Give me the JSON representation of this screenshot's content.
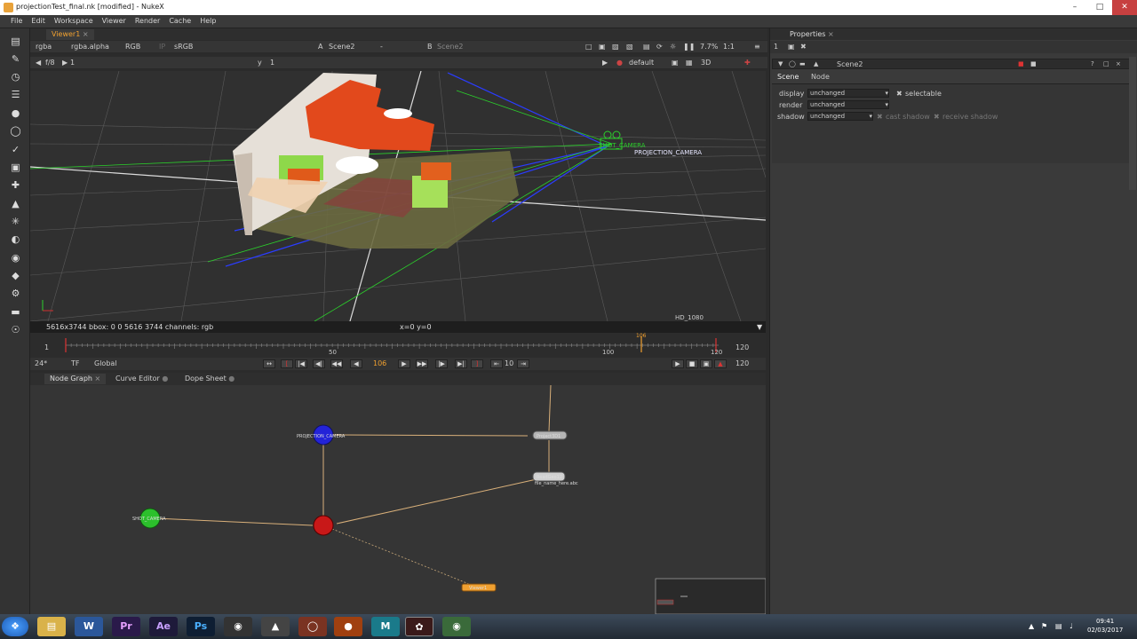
{
  "window": {
    "title": "projectionTest_final.nk [modified] - NukeX"
  },
  "menu": [
    "File",
    "Edit",
    "Workspace",
    "Viewer",
    "Render",
    "Cache",
    "Help"
  ],
  "viewer": {
    "tab": "Viewer1",
    "row1": {
      "channels": "rgba",
      "alpha": "rgba.alpha",
      "colorspace": "RGB",
      "ip": "IP",
      "lut": "sRGB",
      "a_label": "A",
      "a_input": "Scene2",
      "a_dash": "-",
      "b_label": "B",
      "b_input": "Scene2",
      "zoom": "7.7%",
      "ratio": "1:1"
    },
    "row2": {
      "fstop": "f/8",
      "frame": "1",
      "y_label": "y",
      "y_val": "1",
      "camera": "default",
      "mode": "3D"
    },
    "info_left": "5616x3744  bbox: 0 0 5616 3744 channels: rgb",
    "info_mid": "x=0 y=0",
    "format": "HD_1080",
    "camera_label_a": "SHOT_CAMERA",
    "camera_label_b": "PROJECTION_CAMERA"
  },
  "timeline": {
    "start": "1",
    "mark50": "50",
    "mark100": "100",
    "end": "120",
    "current_marker": "106",
    "end_right": "120"
  },
  "playback": {
    "fps": "24*",
    "tf": "TF",
    "global": "Global",
    "current": "106",
    "step": "10",
    "end": "120"
  },
  "nodegraph": {
    "tabs": [
      "Node Graph",
      "Curve Editor",
      "Dope Sheet"
    ],
    "nodes": {
      "projection_camera": "PROJECTION_CAMERA",
      "shot_camera": "SHOT_CAMERA",
      "project": "Project3D1",
      "readgeo": "ReadGeo12",
      "readgeo_sub": "file_name_here.abc",
      "viewer": "Viewer1"
    }
  },
  "properties": {
    "title": "Properties",
    "node_name": "Scene2",
    "tabs": [
      "Scene",
      "Node"
    ],
    "display_label": "display",
    "display_value": "unchanged",
    "render_label": "render",
    "render_value": "unchanged",
    "shadow_label": "shadow",
    "shadow_value": "unchanged",
    "selectable": "selectable",
    "cast_shadow": "cast shadow",
    "receive_shadow": "receive shadow"
  },
  "taskbar": {
    "apps": [
      "W",
      "Pr",
      "Ae",
      "Ps"
    ],
    "time": "09:41",
    "date": "02/03/2017"
  },
  "colors": {
    "accent": "#f0a030",
    "nuke_bg": "#353535",
    "grid": "#555555"
  }
}
